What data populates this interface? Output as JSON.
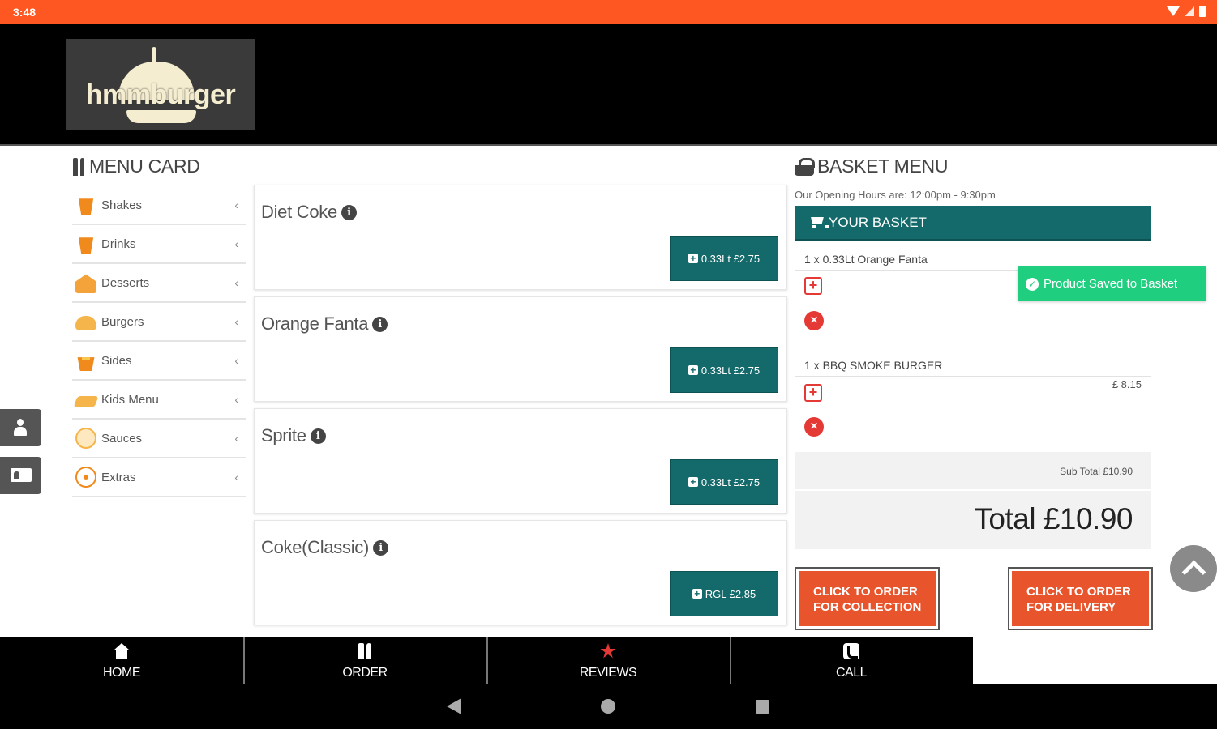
{
  "status_bar": {
    "time": "3:48"
  },
  "brand": {
    "logo_text": "hmmburger"
  },
  "menu": {
    "title": "MENU CARD",
    "categories": [
      {
        "label": "Shakes",
        "icon": "shake-icon"
      },
      {
        "label": "Drinks",
        "icon": "drink-icon"
      },
      {
        "label": "Desserts",
        "icon": "cake-icon"
      },
      {
        "label": "Burgers",
        "icon": "burger-icon"
      },
      {
        "label": "Sides",
        "icon": "fries-icon"
      },
      {
        "label": "Kids Menu",
        "icon": "kids-meal-icon"
      },
      {
        "label": "Sauces",
        "icon": "sauce-icon"
      },
      {
        "label": "Extras",
        "icon": "extras-icon"
      }
    ],
    "chevron": "‹"
  },
  "products": [
    {
      "name": "Diet Coke",
      "button": "0.33Lt £2.75"
    },
    {
      "name": "Orange Fanta",
      "button": "0.33Lt £2.75"
    },
    {
      "name": "Sprite",
      "button": "0.33Lt £2.75"
    },
    {
      "name": "Coke(Classic)",
      "button": "RGL £2.85"
    }
  ],
  "basket": {
    "title": "BASKET MENU",
    "hours": "Our Opening Hours are: 12:00pm - 9:30pm",
    "header": "YOUR BASKET",
    "items": [
      {
        "name": "1 x 0.33Lt Orange Fanta",
        "price": ""
      },
      {
        "name": "1 x BBQ SMOKE BURGER",
        "price": "£ 8.15"
      }
    ],
    "toast": "Product Saved to Basket",
    "subtotal": "Sub Total £10.90",
    "total": "Total £10.90",
    "collection_button": "CLICK TO ORDER FOR COLLECTION",
    "delivery_button": "CLICK TO ORDER FOR DELIVERY"
  },
  "bottom_nav": [
    {
      "label": "HOME",
      "icon": "home-icon"
    },
    {
      "label": "ORDER",
      "icon": "cutlery-icon"
    },
    {
      "label": "REVIEWS",
      "icon": "star-icon"
    },
    {
      "label": "CALL",
      "icon": "phone-icon"
    }
  ],
  "colors": {
    "accent": "#ff5722",
    "teal": "#14696a",
    "order_button": "#e8542c",
    "toast": "#1fce7e",
    "remove": "#e53935"
  }
}
